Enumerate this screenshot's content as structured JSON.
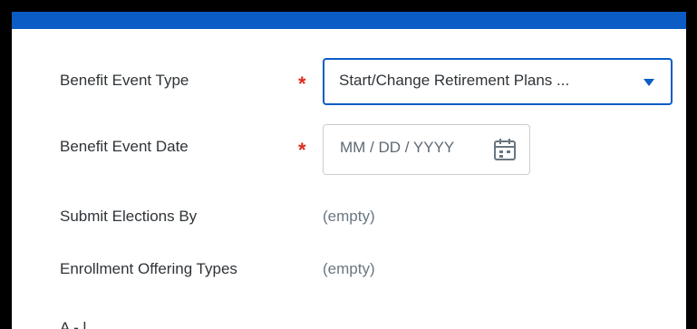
{
  "form": {
    "benefit_event_type": {
      "label": "Benefit Event Type",
      "required_marker": "*",
      "value": "Start/Change Retirement Plans ..."
    },
    "benefit_event_date": {
      "label": "Benefit Event Date",
      "required_marker": "*",
      "placeholder": "MM / DD / YYYY"
    },
    "submit_elections_by": {
      "label": "Submit Elections By",
      "value": "(empty)"
    },
    "enrollment_offering_types": {
      "label": "Enrollment Offering Types",
      "value": "(empty)"
    },
    "partial_next_label": "A  -  l"
  },
  "icons": {
    "dropdown": "chevron-down-icon",
    "date_picker": "calendar-icon"
  },
  "colors": {
    "accent": "#0b5cc4",
    "required": "#de2a1f",
    "label_text": "#2f3438",
    "muted_text": "#6a7680"
  }
}
